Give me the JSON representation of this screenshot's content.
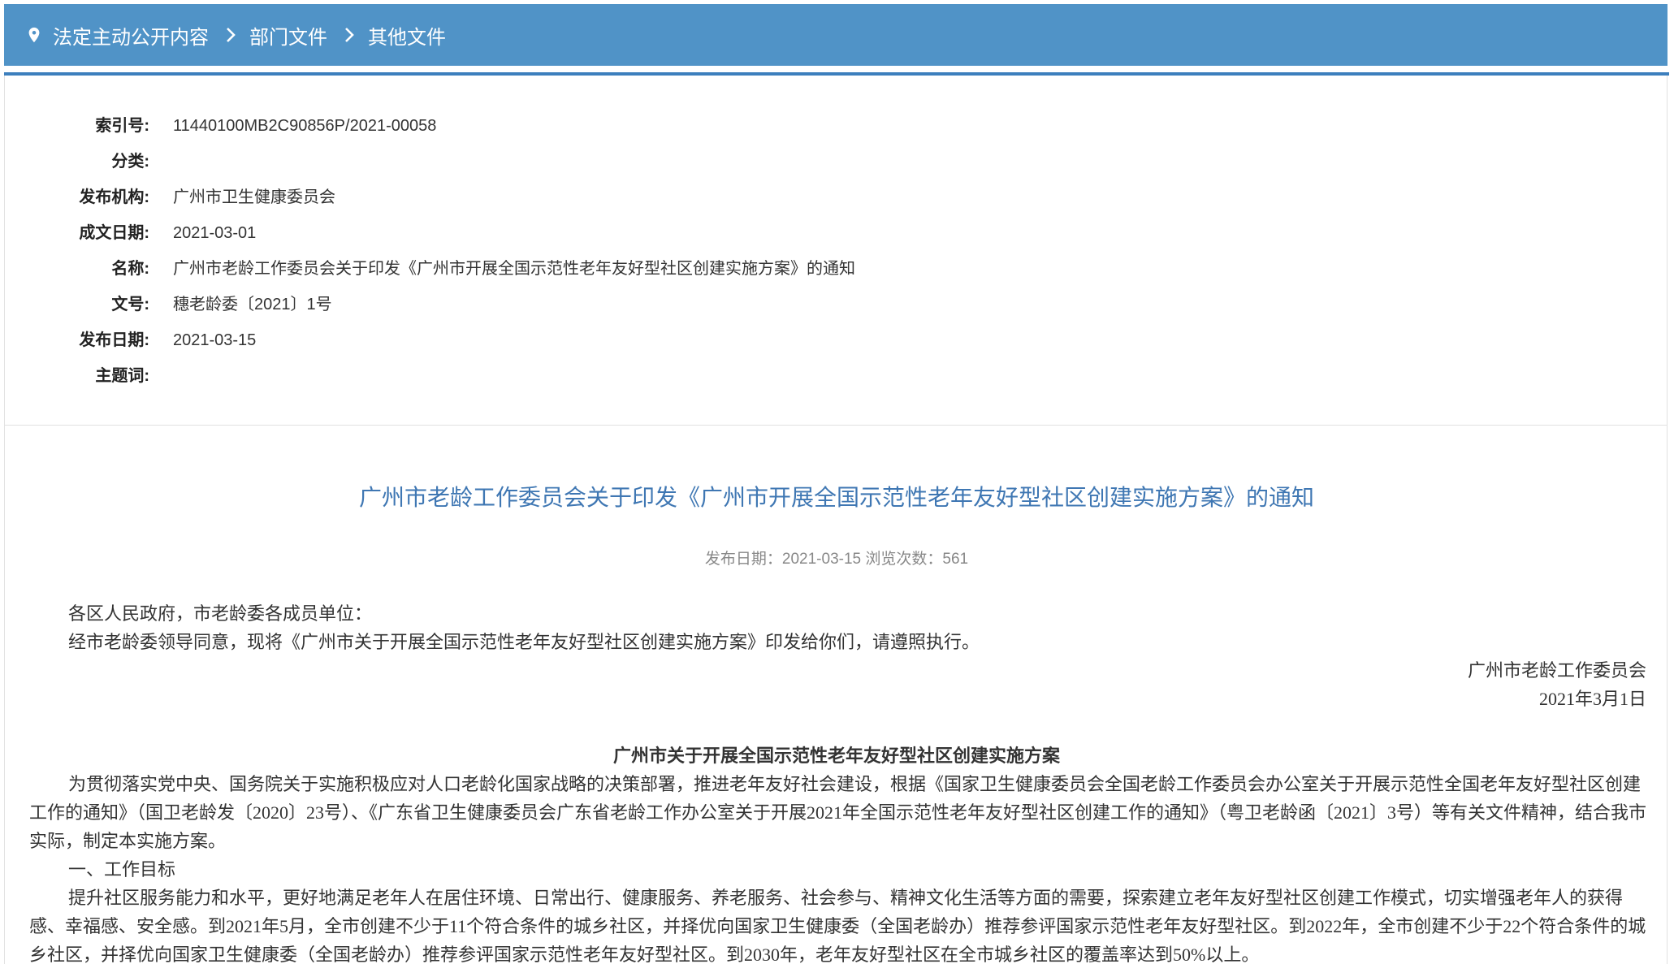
{
  "breadcrumb": {
    "items": [
      "法定主动公开内容",
      "部门文件",
      "其他文件"
    ]
  },
  "meta": {
    "rows": [
      {
        "label": "索引号:",
        "value": "11440100MB2C90856P/2021-00058"
      },
      {
        "label": "分类:",
        "value": ""
      },
      {
        "label": "发布机构:",
        "value": "广州市卫生健康委员会"
      },
      {
        "label": "成文日期:",
        "value": "2021-03-01"
      },
      {
        "label": "名称:",
        "value": "广州市老龄工作委员会关于印发《广州市开展全国示范性老年友好型社区创建实施方案》的通知"
      },
      {
        "label": "文号:",
        "value": "穗老龄委〔2021〕1号"
      },
      {
        "label": "发布日期:",
        "value": "2021-03-15"
      },
      {
        "label": "主题词:",
        "value": ""
      }
    ]
  },
  "article": {
    "title": "广州市老龄工作委员会关于印发《广州市开展全国示范性老年友好型社区创建实施方案》的通知",
    "subline": "发布日期：2021-03-15  浏览次数：561",
    "salutation": "各区人民政府，市老龄委各成员单位：",
    "intro": "经市老龄委领导同意，现将《广州市关于开展全国示范性老年友好型社区创建实施方案》印发给你们，请遵照执行。",
    "signer": "广州市老龄工作委员会",
    "sign_date": "2021年3月1日",
    "plan_title": "广州市关于开展全国示范性老年友好型社区创建实施方案",
    "para1": "为贯彻落实党中央、国务院关于实施积极应对人口老龄化国家战略的决策部署，推进老年友好社会建设，根据《国家卫生健康委员会全国老龄工作委员会办公室关于开展示范性全国老年友好型社区创建工作的通知》（国卫老龄发〔2020〕23号）、《广东省卫生健康委员会广东省老龄工作办公室关于开展2021年全国示范性老年友好型社区创建工作的通知》（粤卫老龄函〔2021〕3号）等有关文件精神，结合我市实际，制定本实施方案。",
    "section1": "一、工作目标",
    "para2": "提升社区服务能力和水平，更好地满足老年人在居住环境、日常出行、健康服务、养老服务、社会参与、精神文化生活等方面的需要，探索建立老年友好型社区创建工作模式，切实增强老年人的获得感、幸福感、安全感。到2021年5月，全市创建不少于11个符合条件的城乡社区，并择优向国家卫生健康委（全国老龄办）推荐参评国家示范性老年友好型社区。到2022年，全市创建不少于22个符合条件的城乡社区，并择优向国家卫生健康委（全国老龄办）推荐参评国家示范性老年友好型社区。到2030年，老年友好型社区在全市城乡社区的覆盖率达到50%以上。"
  }
}
